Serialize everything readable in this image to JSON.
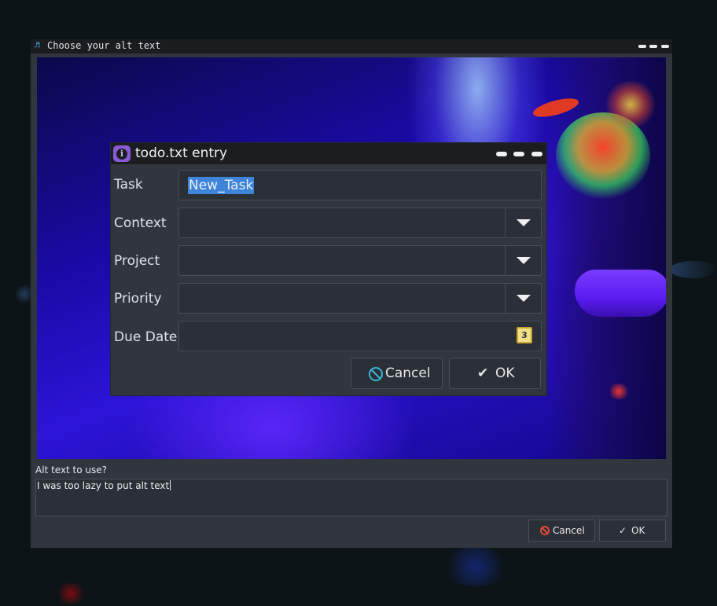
{
  "outer_window": {
    "app_icon": "music-note-icon",
    "title": "Choose your alt text",
    "alt_label": "Alt text to use?",
    "alt_value": "I was too lazy to put alt text",
    "cancel_label": "Cancel",
    "ok_label": "OK"
  },
  "todo_dialog": {
    "app_icon": "info-icon",
    "title": "todo.txt entry",
    "fields": {
      "task": {
        "label": "Task",
        "value": "New_Task"
      },
      "context": {
        "label": "Context",
        "value": ""
      },
      "project": {
        "label": "Project",
        "value": ""
      },
      "priority": {
        "label": "Priority",
        "value": ""
      },
      "due_date": {
        "label": "Due Date:",
        "value": "",
        "calendar_icon_text": "3"
      }
    },
    "cancel_label": "Cancel",
    "ok_label": "OK"
  },
  "icons": {
    "check": "✔",
    "check_small": "✓",
    "music": "♬"
  },
  "colors": {
    "selection": "#3e84d8",
    "cancel_icon": "#38b6d6",
    "outer_cancel_icon": "#e04a3a"
  }
}
